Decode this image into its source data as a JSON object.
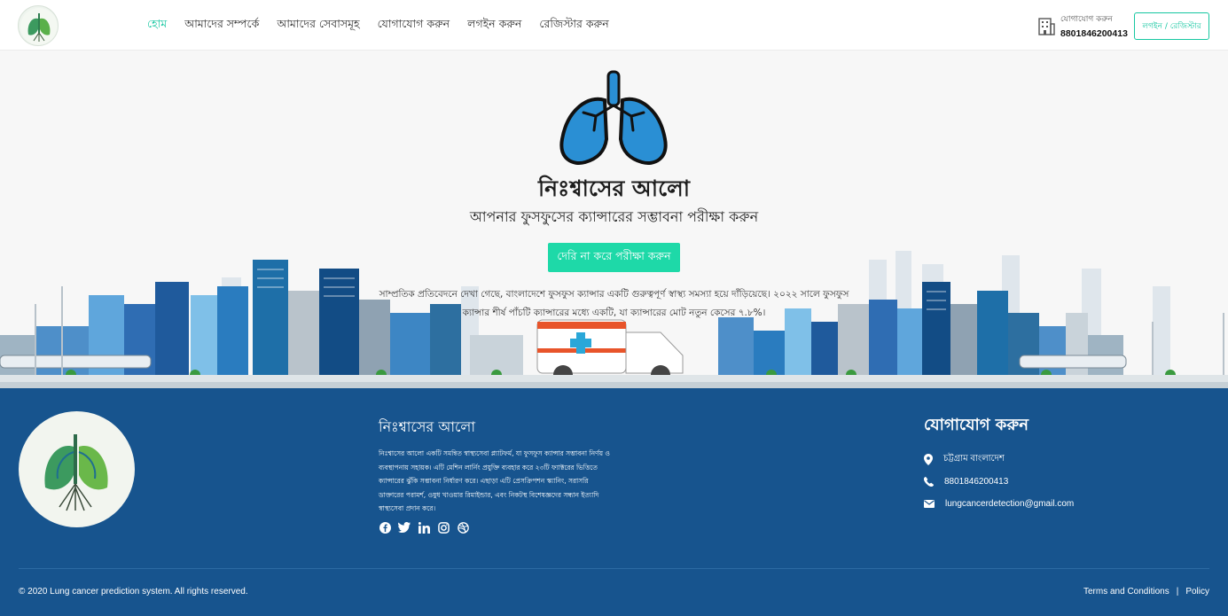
{
  "header": {
    "nav": [
      {
        "label": "হোম",
        "active": true
      },
      {
        "label": "আমাদের সম্পর্কে",
        "active": false
      },
      {
        "label": "আমাদের সেবাসমূহ",
        "active": false
      },
      {
        "label": "যোগাযোগ করুন",
        "active": false
      },
      {
        "label": "লগইন করুন",
        "active": false
      },
      {
        "label": "রেজিস্টার করুন",
        "active": false
      }
    ],
    "contact_label": "যোগাযোগ করুন",
    "contact_phone": "8801846200413",
    "login_button": "লগইন / রেজিস্টার"
  },
  "hero": {
    "title": "নিঃশ্বাসের আলো",
    "tagline": "আপনার ফুসফুসের ক্যান্সারের সম্ভাবনা পরীক্ষা করুন",
    "cta": "দেরি না করে পরীক্ষা করুন",
    "paragraph": "সাম্প্রতিক প্রতিবেদনে দেখা গেছে, বাংলাদেশে ফুসফুস ক্যান্সার একটি গুরুত্বপূর্ণ স্বাস্থ্য সমস্যা হয়ে দাঁড়িয়েছে। ২০২২ সালে ফুসফুস ক্যান্সার শীর্ষ পাঁচটি ক্যান্সারের মধ্যে একটি, যা ক্যান্সারের মোট নতুন কেসের ৭.৮%।"
  },
  "footer": {
    "title": "নিঃশ্বাসের আলো",
    "description": "নিঃশ্বাসের আলো একটি সমন্বিত স্বাস্থ্যসেবা প্ল্যাটফর্ম, যা ফুসফুস ক্যান্সার সম্ভাবনা নির্ণয় ও ব্যবস্থাপনায় সহায়ক। এটি মেশিন লার্নিং প্রযুক্তি ব্যবহার করে ২৩টি ফ্যাক্টরের ভিত্তিতে ক্যান্সারের ঝুঁকি সম্ভাবনা নির্ধারণ করে। এছাড়া এটি প্রেসক্রিপশন স্ক্যানিং, সরাসরি ডাক্তারের পরামর্শ, ওষুধ খাওয়ার রিমাইন্ডার, এবং নিকটস্থ বিশেষজ্ঞদের সন্ধান ইত্যাদি স্বাস্থ্যসেবা প্রদান করে।",
    "socials": [
      "facebook-icon",
      "twitter-icon",
      "linkedin-icon",
      "instagram-icon",
      "dribbble-icon"
    ],
    "contact_title": "যোগাযোগ করুন",
    "address": "চট্টগ্রাম বাংলাদেশ",
    "phone": "8801846200413",
    "email": "lungcancerdetection@gmail.com",
    "copyright": "© 2020 Lung cancer prediction system. All rights reserved.",
    "terms": "Terms and Conditions",
    "separator": "|",
    "policy": "Policy"
  },
  "colors": {
    "accent": "#16c7a1",
    "cta": "#1ed9a8",
    "footer_bg": "#17548e",
    "lung_blue": "#2a8fd4"
  }
}
